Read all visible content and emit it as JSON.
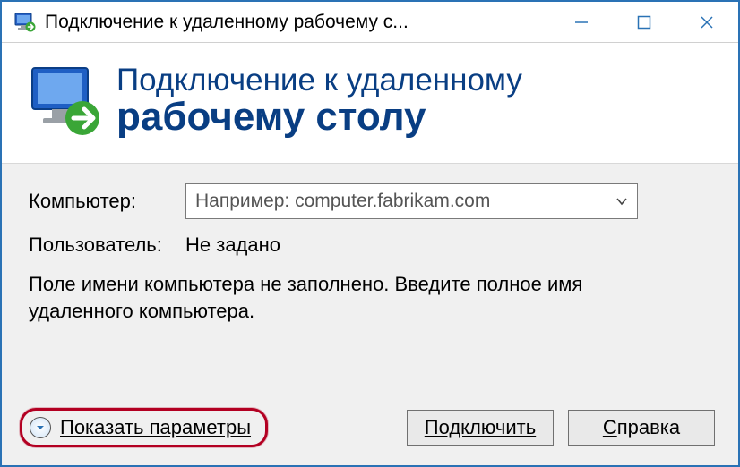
{
  "titlebar": {
    "title": "Подключение к удаленному рабочему с..."
  },
  "banner": {
    "line1": "Подключение к удаленному",
    "line2": "рабочему столу"
  },
  "form": {
    "computer_label": "Компьютер:",
    "computer_placeholder": "Например: computer.fabrikam.com",
    "computer_value": "",
    "user_label": "Пользователь:",
    "user_value": "Не задано",
    "hint": "Поле имени компьютера не заполнено. Введите полное имя удаленного компьютера."
  },
  "footer": {
    "show_params": "Показать параметры",
    "connect": "Подключить",
    "help_underline": "С",
    "help_rest": "правка"
  }
}
